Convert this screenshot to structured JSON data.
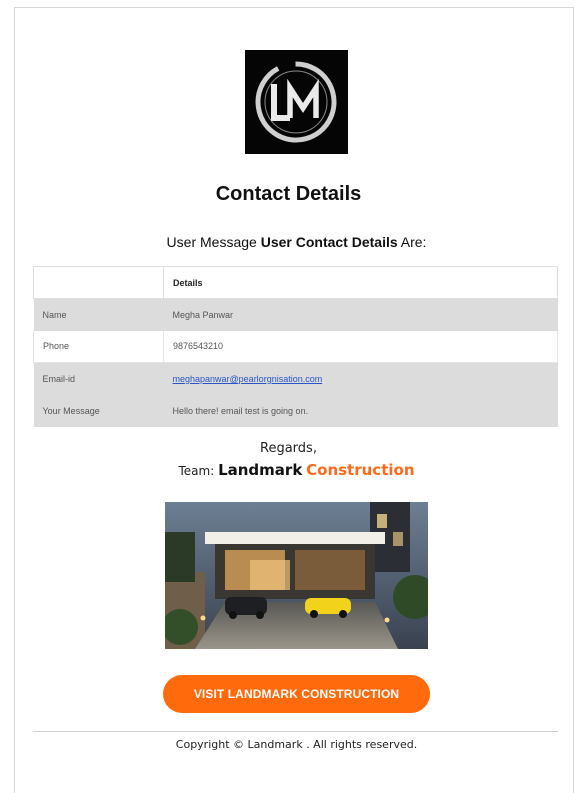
{
  "header": {
    "logo_text": "LM",
    "title": "Contact Details",
    "subtitle_prefix": "User Message ",
    "subtitle_bold": "User Contact Details",
    "subtitle_suffix": " Are:"
  },
  "table": {
    "header": {
      "col1": "",
      "col2": "Details"
    },
    "rows": [
      {
        "label": "Name",
        "value": "Megha Panwar"
      },
      {
        "label": "Phone",
        "value": "9876543210"
      },
      {
        "label": "Email-id",
        "value": "meghapanwar@pearlorgnisation.com"
      },
      {
        "label": "Your Message",
        "value": "Hello there! email test is going on."
      }
    ]
  },
  "footer": {
    "regards": "Regards,",
    "team_prefix": "Team: ",
    "brand_part1": "Landmark",
    "brand_part2": "Construction",
    "cta_label": "VISIT LANDMARK CONSTRUCTION",
    "copyright": "Copyright © Landmark . All rights reserved."
  },
  "colors": {
    "accent": "#ff6a0c",
    "link": "#2a55c9",
    "row_grey": "#dcdcdc"
  },
  "icons": {
    "logo": "lm-monogram-logo",
    "photo": "house-photo"
  }
}
